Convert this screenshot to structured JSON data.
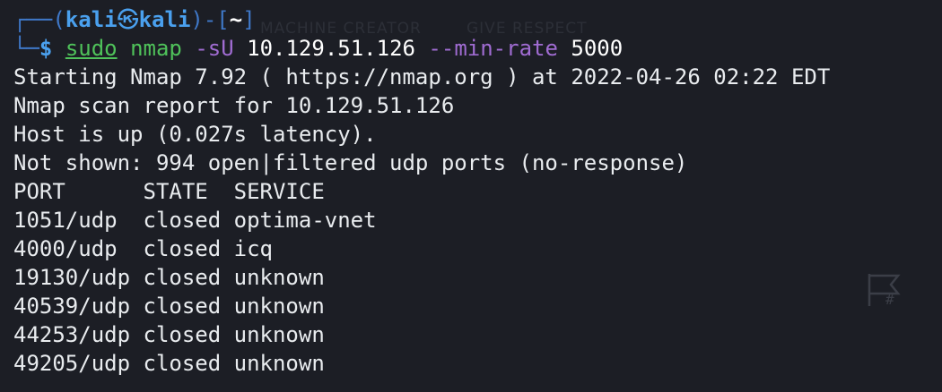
{
  "prompt": {
    "user": "kali",
    "host": "kali",
    "separator_icon": "㉿",
    "cwd": "~",
    "symbol": "$"
  },
  "command": {
    "sudo": "sudo",
    "program": "nmap",
    "flag1": "-sU",
    "target": "10.129.51.126",
    "flag2": "--min-rate",
    "flag2_value": "5000"
  },
  "output": {
    "start_line": "Starting Nmap 7.92 ( https://nmap.org ) at 2022-04-26 02:22 EDT",
    "report_line": "Nmap scan report for 10.129.51.126",
    "host_line": "Host is up (0.027s latency).",
    "not_shown_line": "Not shown: 994 open|filtered udp ports (no-response)",
    "header_line": "PORT      STATE  SERVICE",
    "rows": [
      "1051/udp  closed optima-vnet",
      "4000/udp  closed icq",
      "19130/udp closed unknown",
      "40539/udp closed unknown",
      "44253/udp closed unknown",
      "49205/udp closed unknown"
    ]
  },
  "background": {
    "ghost_text_1": "MACHINE CREATOR",
    "ghost_text_2": "GIVE RESPECT",
    "ghost_icon": "flag-hash-icon"
  },
  "colors": {
    "background": "#1c1e25",
    "prompt_blue": "#4aa0ee",
    "command_green": "#4fc25a",
    "flag_purple": "#a06cd2",
    "text": "#e9ecef"
  }
}
